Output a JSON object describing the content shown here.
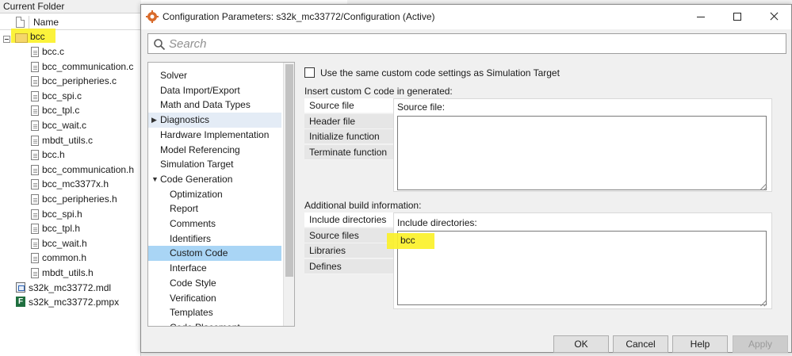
{
  "folder_panel": {
    "title": "Current Folder",
    "column_name": "Name",
    "root_folder": "bcc",
    "files": [
      "bcc.c",
      "bcc_communication.c",
      "bcc_peripheries.c",
      "bcc_spi.c",
      "bcc_tpl.c",
      "bcc_wait.c",
      "mbdt_utils.c",
      "bcc.h",
      "bcc_communication.h",
      "bcc_mc3377x.h",
      "bcc_peripheries.h",
      "bcc_spi.h",
      "bcc_tpl.h",
      "bcc_wait.h",
      "common.h",
      "mbdt_utils.h"
    ],
    "model_file": "s32k_mc33772.mdl",
    "project_file": "s32k_mc33772.pmpx",
    "project_icon_letter": "F"
  },
  "dialog": {
    "title": "Configuration Parameters: s32k_mc33772/Configuration (Active)",
    "search": {
      "placeholder": "Search"
    },
    "nav": [
      {
        "label": "Solver",
        "indent": 0
      },
      {
        "label": "Data Import/Export",
        "indent": 0
      },
      {
        "label": "Math and Data Types",
        "indent": 0
      },
      {
        "label": "Diagnostics",
        "indent": 0,
        "arrow": "right"
      },
      {
        "label": "Hardware Implementation",
        "indent": 0
      },
      {
        "label": "Model Referencing",
        "indent": 0
      },
      {
        "label": "Simulation Target",
        "indent": 0
      },
      {
        "label": "Code Generation",
        "indent": 0,
        "arrow": "down"
      },
      {
        "label": "Optimization",
        "indent": 1
      },
      {
        "label": "Report",
        "indent": 1
      },
      {
        "label": "Comments",
        "indent": 1
      },
      {
        "label": "Identifiers",
        "indent": 1
      },
      {
        "label": "Custom Code",
        "indent": 1,
        "selected": true
      },
      {
        "label": "Interface",
        "indent": 1
      },
      {
        "label": "Code Style",
        "indent": 1
      },
      {
        "label": "Verification",
        "indent": 1
      },
      {
        "label": "Templates",
        "indent": 1
      },
      {
        "label": "Code Placement",
        "indent": 1
      }
    ],
    "same_settings_label": "Use the same custom code settings as Simulation Target",
    "insert_group": {
      "label": "Insert custom C code in generated:",
      "tabs": [
        "Source file",
        "Header file",
        "Initialize function",
        "Terminate function"
      ],
      "active_label": "Source file:",
      "value": ""
    },
    "build_group": {
      "label": "Additional build information:",
      "tabs": [
        "Include directories",
        "Source files",
        "Libraries",
        "Defines"
      ],
      "active_label": "Include directories:",
      "value": "bcc"
    },
    "buttons": {
      "ok": "OK",
      "cancel": "Cancel",
      "help": "Help",
      "apply": "Apply"
    }
  },
  "colors": {
    "highlight": "#fbf12a",
    "nav_selected": "#a9d5f5",
    "nav_hover": "#e4ecf6"
  }
}
